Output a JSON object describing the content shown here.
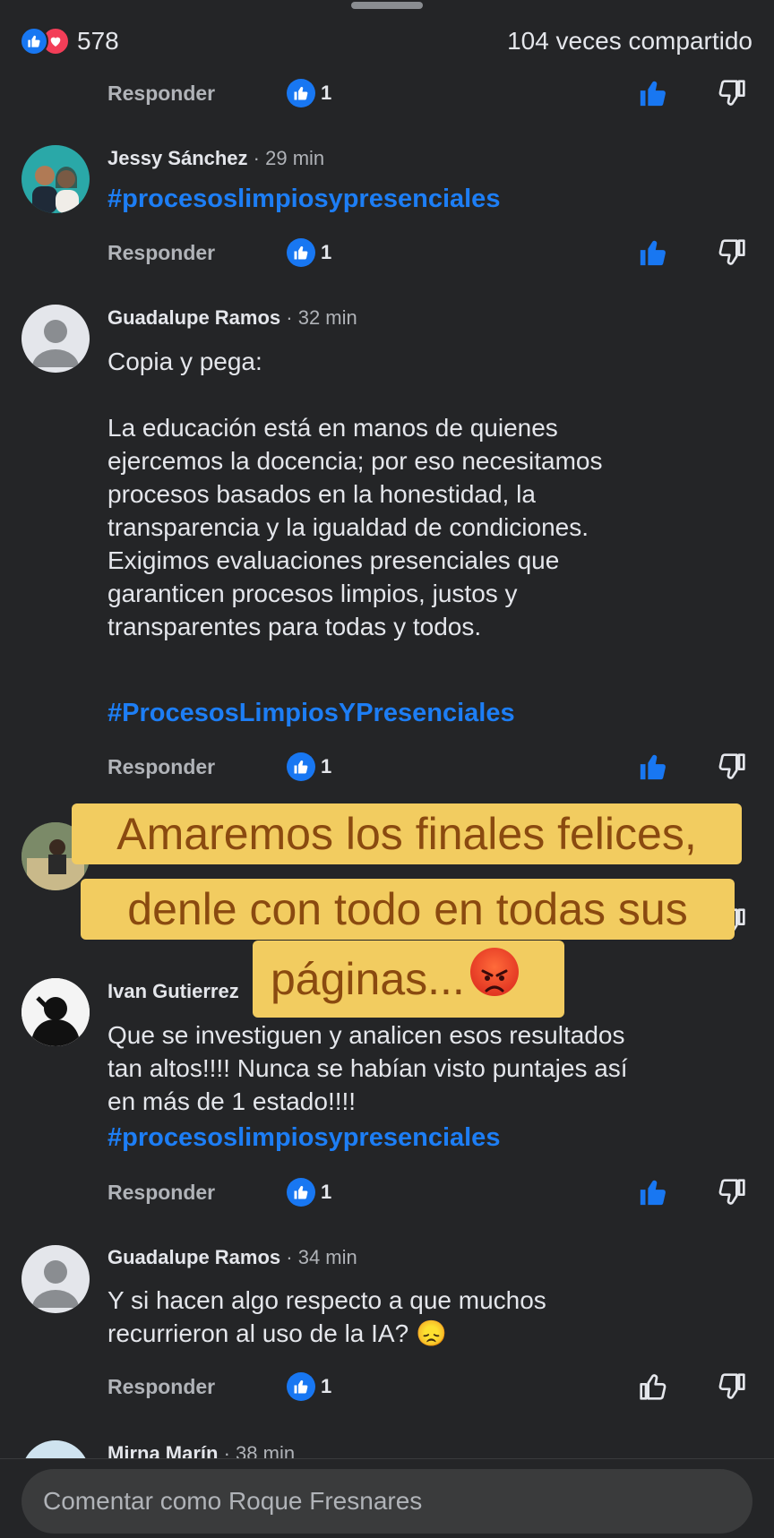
{
  "header": {
    "reaction_count": "578",
    "shares_label": "104 veces compartido"
  },
  "comments": [
    {
      "author": "",
      "time": "",
      "text": "",
      "hashtag": "",
      "reply_label": "Responder",
      "like_count": "1"
    },
    {
      "author": "Jessy Sánchez",
      "time": "· 29 min",
      "text": "",
      "hashtag": "#procesoslimpiosypresenciales",
      "reply_label": "Responder",
      "like_count": "1"
    },
    {
      "author": "Guadalupe Ramos",
      "time": "· 32 min",
      "text": "Copia y pega:\n\nLa educación está en manos de quienes\nejercemos la docencia; por eso necesitamos\nprocesos basados en la honestidad, la\ntransparencia y la igualdad de condiciones.\nExigimos evaluaciones presenciales que\ngaranticen procesos limpios, justos y\ntransparentes para todas y todos.",
      "hashtag": "#ProcesosLimpiosYPresenciales",
      "reply_label": "Responder",
      "like_count": "1"
    },
    {
      "author": "Ivan Gutierrez",
      "time": "",
      "text": "Que se investiguen y analicen esos resultados\ntan altos!!!! Nunca se habían visto puntajes así\nen más de 1 estado!!!!",
      "hashtag": "#procesoslimpiosypresenciales",
      "reply_label": "Responder",
      "like_count": "1"
    },
    {
      "author": "Guadalupe Ramos",
      "time": "· 34 min",
      "text": "Y si hacen algo respecto a que muchos\nrecurrieron al uso de la IA? 😞",
      "hashtag": "",
      "reply_label": "Responder",
      "like_count": "1"
    },
    {
      "author": "Mirna Marín",
      "time": "· 38 min"
    }
  ],
  "overlay": {
    "line1": "Amaremos los finales felices,",
    "line2": "denle con todo en todas sus",
    "line3": "páginas..."
  },
  "composer": {
    "placeholder": "Comentar como Roque Fresnares"
  },
  "colors": {
    "background": "#242527",
    "like_blue": "#1877f2",
    "hashtag_blue": "#1d7ef5",
    "overlay_bg": "#f2cc60",
    "overlay_text": "#8a4a10"
  }
}
